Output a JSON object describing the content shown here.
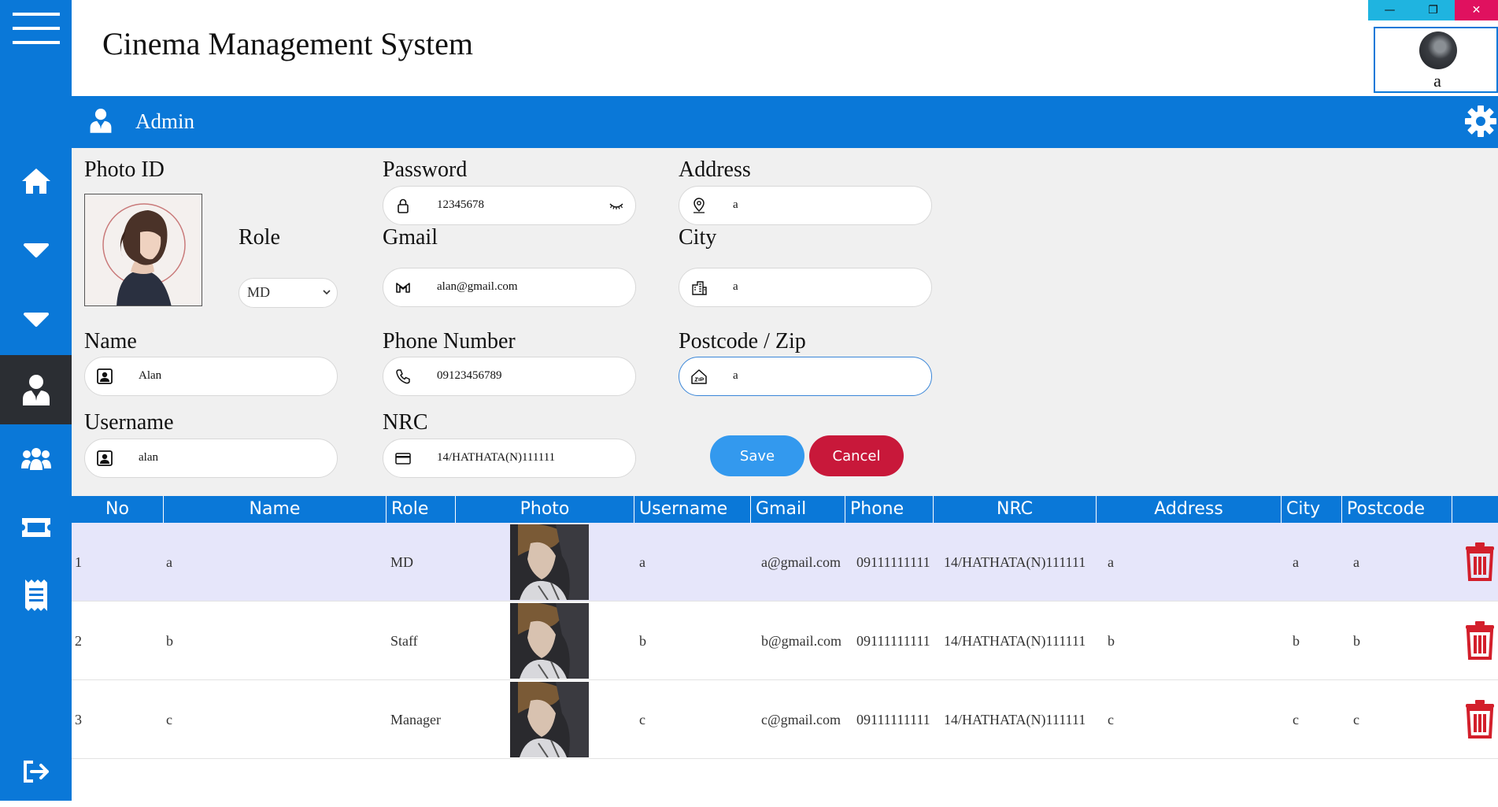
{
  "app": {
    "title": "Cinema Management System"
  },
  "window": {
    "min": "—",
    "max": "❐",
    "close": "✕"
  },
  "user": {
    "name": "a"
  },
  "adminbar": {
    "label": "Admin"
  },
  "form": {
    "photo_label": "Photo ID",
    "role_label": "Role",
    "role_value": "MD",
    "password_label": "Password",
    "password_value": "12345678",
    "gmail_label": "Gmail",
    "gmail_value": "alan@gmail.com",
    "address_label": "Address",
    "address_value": "a",
    "city_label": "City",
    "city_value": "a",
    "name_label": "Name",
    "name_value": "Alan",
    "phone_label": "Phone Number",
    "phone_value": "09123456789",
    "postcode_label": "Postcode / Zip",
    "postcode_value": "a",
    "username_label": "Username",
    "username_value": "alan",
    "nrc_label": "NRC",
    "nrc_value": "14/HATHATA(N)111111",
    "save_label": "Save",
    "cancel_label": "Cancel"
  },
  "table": {
    "headers": [
      "No",
      "Name",
      "Role",
      "Photo",
      "Username",
      "Gmail",
      "Phone",
      "NRC",
      "Address",
      "City",
      "Postcode"
    ],
    "rows": [
      {
        "no": "1",
        "name": "a",
        "role": "MD",
        "username": "a",
        "gmail": "a@gmail.com",
        "phone": "09111111111",
        "nrc": "14/HATHATA(N)111111",
        "address": "a",
        "city": "a",
        "postcode": "a",
        "selected": true
      },
      {
        "no": "2",
        "name": "b",
        "role": "Staff",
        "username": "b",
        "gmail": "b@gmail.com",
        "phone": "09111111111",
        "nrc": "14/HATHATA(N)111111",
        "address": "b",
        "city": "b",
        "postcode": "b",
        "selected": false
      },
      {
        "no": "3",
        "name": "c",
        "role": "Manager",
        "username": "c",
        "gmail": "c@gmail.com",
        "phone": "09111111111",
        "nrc": "14/HATHATA(N)111111",
        "address": "c",
        "city": "c",
        "postcode": "c",
        "selected": false
      }
    ]
  },
  "sidebar": {
    "items": [
      "menu-icon",
      "home-icon",
      "dropdown-icon",
      "dropdown-icon",
      "admin-user-icon",
      "group-icon",
      "ticket-icon",
      "receipt-icon",
      "logout-icon"
    ],
    "active": "admin-user-icon"
  },
  "colors": {
    "brand": "#0a78d8",
    "save": "#3399ee",
    "cancel": "#c8183a",
    "delete": "#d31f2b",
    "selected_row": "#e6e6fa",
    "sidebar_active": "#2b2e33"
  }
}
